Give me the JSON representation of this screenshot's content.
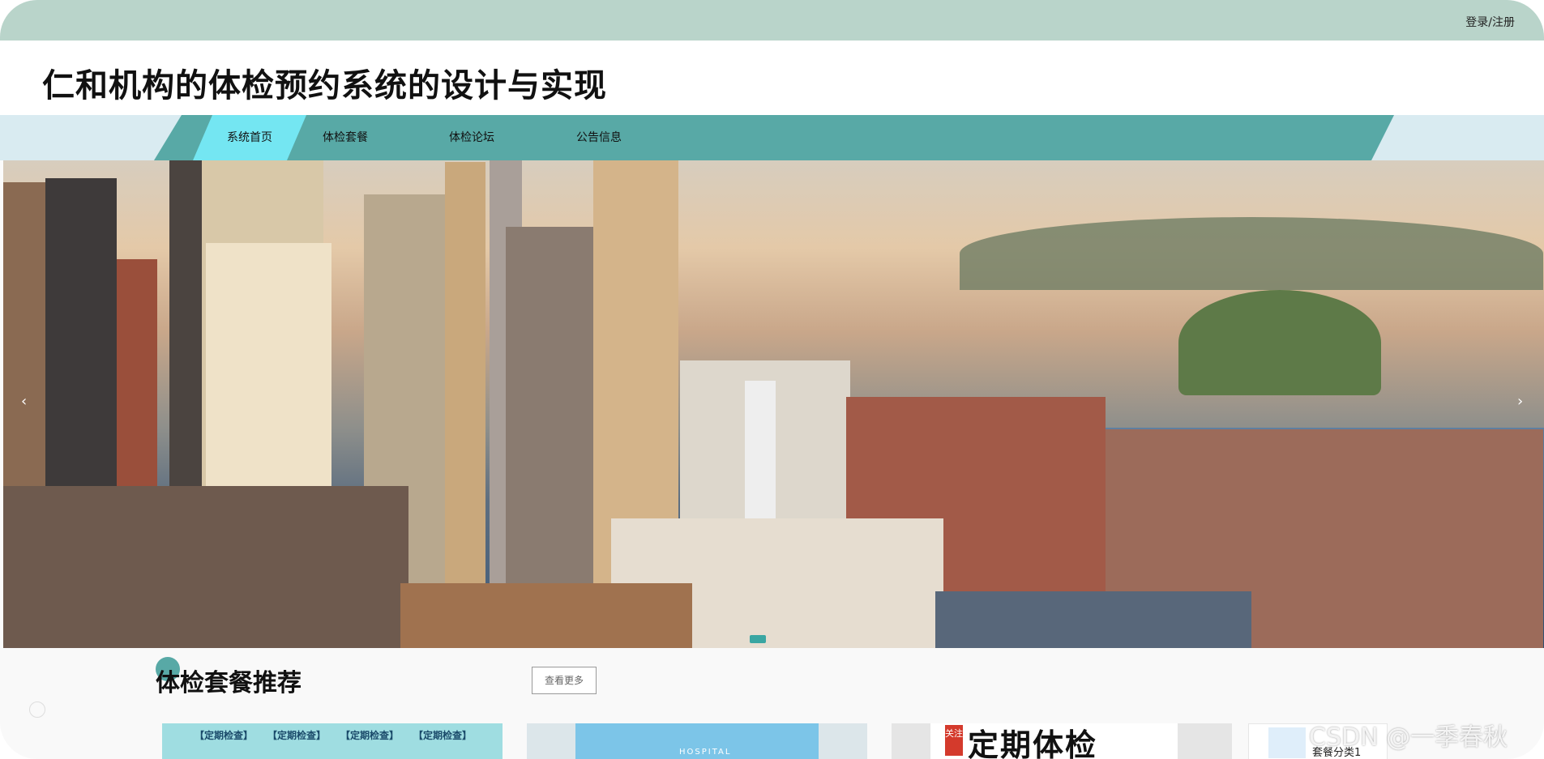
{
  "header": {
    "login_label": "登录/注册"
  },
  "site": {
    "title": "仁和机构的体检预约系统的设计与实现"
  },
  "nav": {
    "items": [
      "系统首页",
      "体检套餐",
      "体检论坛",
      "公告信息"
    ],
    "active": 0
  },
  "banner": {
    "prev": "‹",
    "next": "›"
  },
  "section": {
    "title": "体检套餐推荐",
    "more_label": "查看更多"
  },
  "cards": {
    "c1_tags": [
      "【定期检查】",
      "【定期检查】",
      "【定期检查】",
      "【定期检查】"
    ],
    "c2_text": "HOSPITAL",
    "c3_badge": "关注",
    "c3_text": "定期体检",
    "c4_label": "套餐分类1"
  },
  "watermark": "CSDN @一季春秋",
  "colors": {
    "topbar": "#b9d4ca",
    "nav": "#58a9a6",
    "nav_active": "#74e6f2",
    "accent": "#3aa6a2"
  }
}
